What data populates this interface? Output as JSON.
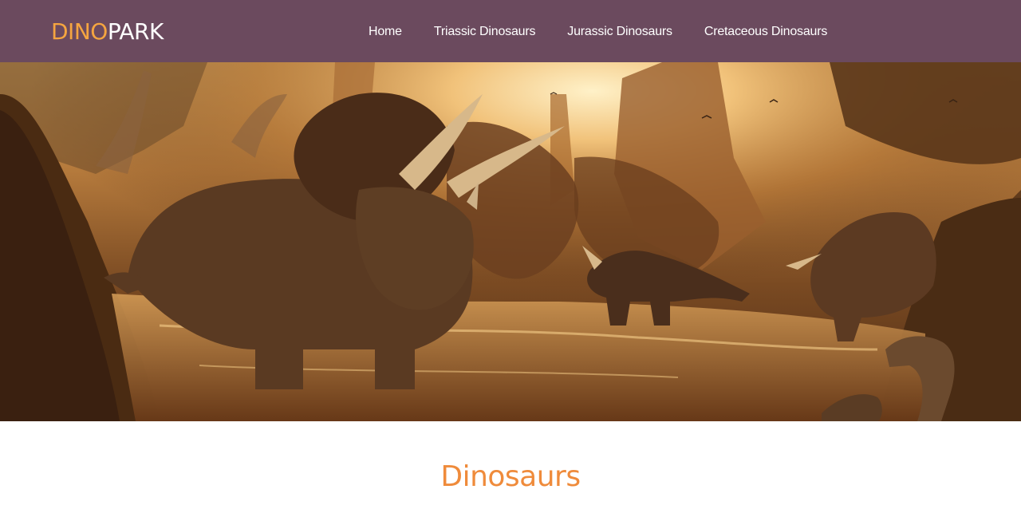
{
  "brand": {
    "part1": "DINO",
    "part2": "PARK",
    "color_part1": "#f5a540",
    "color_part2": "#ffffff"
  },
  "nav": {
    "items": [
      {
        "label": "Home"
      },
      {
        "label": "Triassic Dinosaurs"
      },
      {
        "label": "Jurassic Dinosaurs"
      },
      {
        "label": "Cretaceous Dinosaurs"
      }
    ]
  },
  "hero": {
    "alt": "Triceratops herd wading through a river at sunset"
  },
  "main": {
    "title": "Dinosaurs"
  },
  "colors": {
    "navbar_bg": "#6b4a5e",
    "accent": "#ef8b3b"
  }
}
